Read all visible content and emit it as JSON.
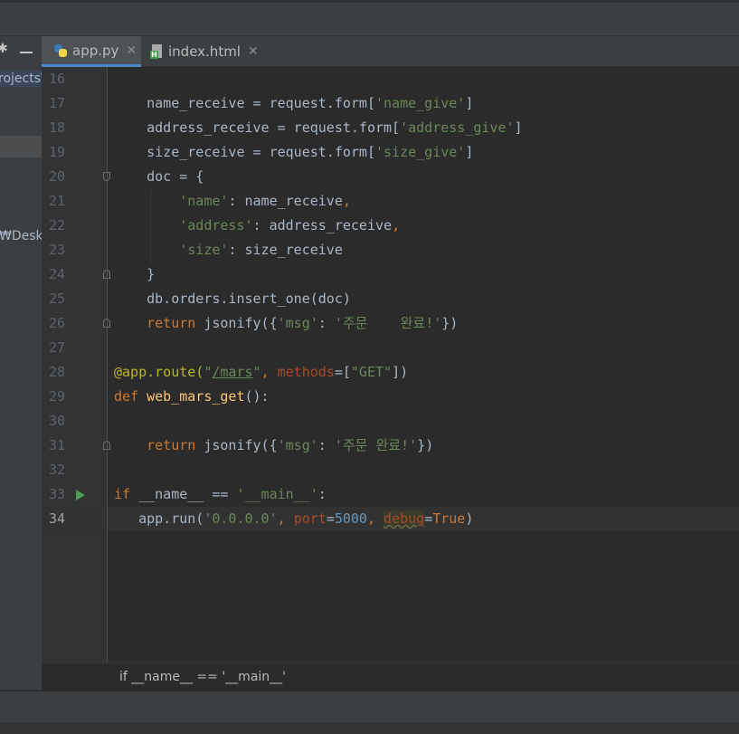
{
  "sidebar": {
    "projects_text": "rojects\\",
    "desktop_text": "₩Deskt"
  },
  "tabs": [
    {
      "label": "app.py",
      "active": true,
      "icon": "python-file-icon"
    },
    {
      "label": "index.html",
      "active": false,
      "icon": "html-file-icon"
    }
  ],
  "editor": {
    "current_line": 34,
    "lines": [
      {
        "n": "16"
      },
      {
        "n": "17"
      },
      {
        "n": "18"
      },
      {
        "n": "19"
      },
      {
        "n": "20"
      },
      {
        "n": "21"
      },
      {
        "n": "22"
      },
      {
        "n": "23"
      },
      {
        "n": "24"
      },
      {
        "n": "25"
      },
      {
        "n": "26"
      },
      {
        "n": "27"
      },
      {
        "n": "28"
      },
      {
        "n": "29"
      },
      {
        "n": "30"
      },
      {
        "n": "31"
      },
      {
        "n": "32"
      },
      {
        "n": "33"
      },
      {
        "n": "34"
      }
    ],
    "code": {
      "l17_a": "    name_receive = request.form[",
      "l17_s": "'name_give'",
      "l17_b": "]",
      "l18_a": "    address_receive = request.form[",
      "l18_s": "'address_give'",
      "l18_b": "]",
      "l19_a": "    size_receive = request.form[",
      "l19_s": "'size_give'",
      "l19_b": "]",
      "l20": "    doc = {",
      "l21_s": "'name'",
      "l21_b": ": name_receive",
      "l22_s": "'address'",
      "l22_b": ": address_receive",
      "l23_s": "'size'",
      "l23_b": ": size_receive",
      "l24": "    }",
      "l25": "    db.orders.insert_one(doc)",
      "l26_kw": "return",
      "l26_a": " jsonify({",
      "l26_s1": "'msg'",
      "l26_c": ": ",
      "l26_s2": "'주문    완료!'",
      "l26_b": "})",
      "l28_deco": "@app.route(",
      "l28_q1": "\"",
      "l28_link": "/mars",
      "l28_q2": "\"",
      "l28_comma": ", ",
      "l28_param": "methods",
      "l28_eq": "=[",
      "l28_s": "\"GET\"",
      "l28_end": "])",
      "l29_kw": "def ",
      "l29_fn": "web_mars_get",
      "l29_end": "():",
      "l31_kw": "return",
      "l31_a": " jsonify({",
      "l31_s1": "'msg'",
      "l31_c": ": ",
      "l31_s2": "'주문 완료!'",
      "l31_b": "})",
      "l33_kw": "if ",
      "l33_a": "__name__ == ",
      "l33_s": "'__main__'",
      "l33_b": ":",
      "l34_a": "   app.run(",
      "l34_s": "'0.0.0.0'",
      "l34_c1": ", ",
      "l34_p1": "port",
      "l34_eq1": "=",
      "l34_n": "5000",
      "l34_c2": ", ",
      "l34_p2": "debug",
      "l34_eq2": "=",
      "l34_kw": "True",
      "l34_end": ")"
    }
  },
  "breadcrumb": {
    "text": "if __name__ == '__main__'"
  },
  "colors": {
    "background": "#2b2b2b",
    "keyword": "#cc7832",
    "string": "#6a8759",
    "number": "#6897bb",
    "function": "#ffc66d",
    "decorator": "#bbb529",
    "tab_underline": "#4a88c7"
  }
}
